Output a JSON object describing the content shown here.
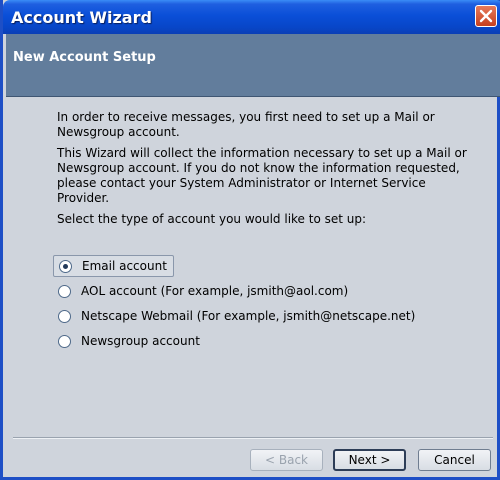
{
  "window": {
    "title": "Account Wizard",
    "close_icon": "close-icon"
  },
  "header": {
    "title": "New Account Setup"
  },
  "content": {
    "intro1": "In order to receive messages, you first need to set up a Mail or Newsgroup account.",
    "intro2": "This Wizard will collect the information necessary to set up a Mail or Newsgroup account. If you do not know the information requested, please contact your System Administrator or Internet Service Provider.",
    "prompt": "Select the type of account you would like to set up:"
  },
  "options": [
    {
      "label": "Email account",
      "selected": true
    },
    {
      "label": "AOL account (For example, jsmith@aol.com)",
      "selected": false
    },
    {
      "label": "Netscape Webmail (For example, jsmith@netscape.net)",
      "selected": false
    },
    {
      "label": "Newsgroup account",
      "selected": false
    }
  ],
  "buttons": {
    "back": "< Back",
    "next": "Next >",
    "cancel": "Cancel"
  },
  "colors": {
    "titlebar": "#0a4fd8",
    "header_band": "#627d9c",
    "window_bg": "#cfd4dc"
  }
}
